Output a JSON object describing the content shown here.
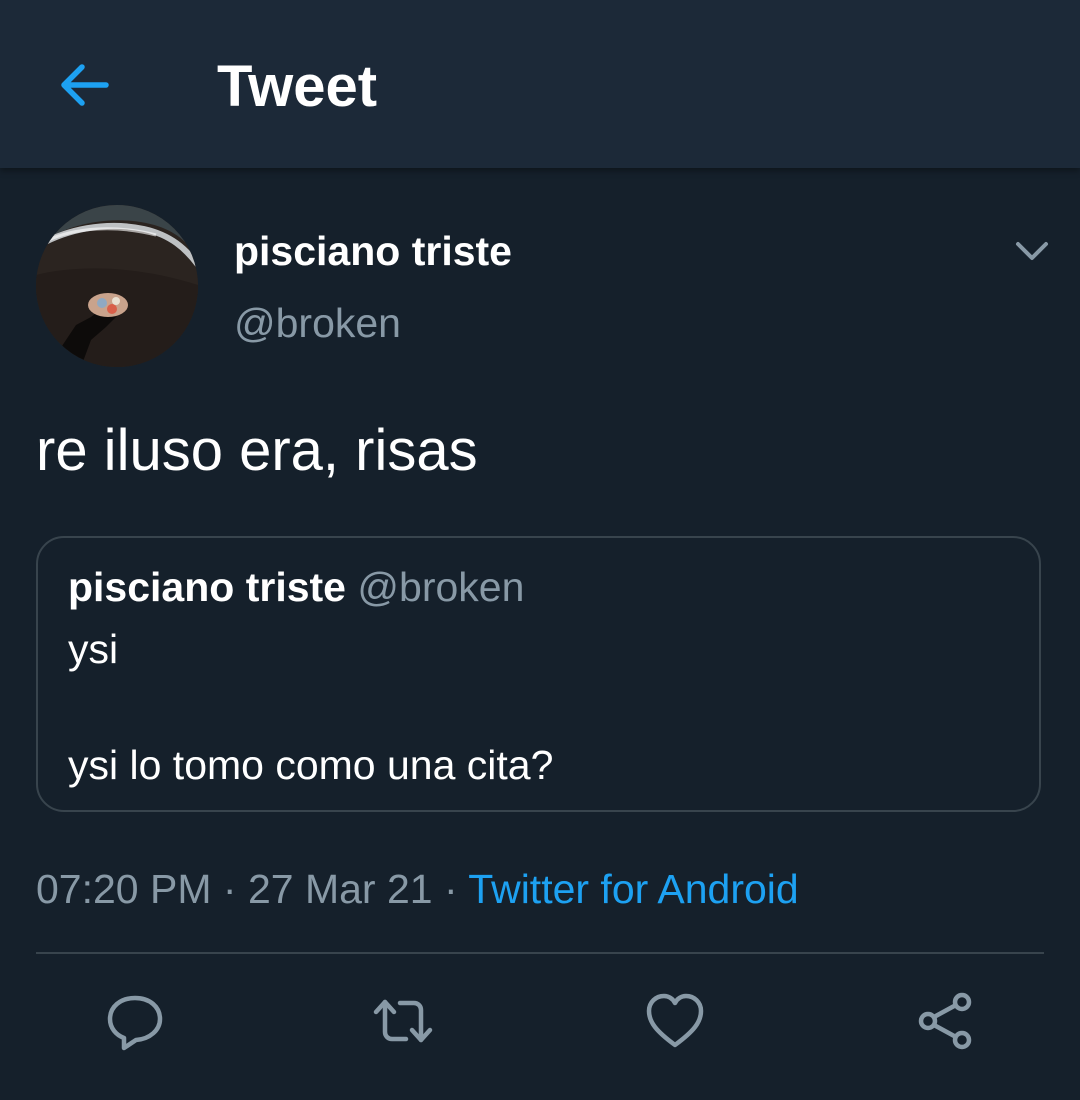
{
  "header": {
    "title": "Tweet",
    "back_icon": "arrow-left-icon",
    "accent_color": "#1da1f2"
  },
  "tweet": {
    "author_name": "pisciano triste",
    "author_handle": "@broken",
    "text": "re iluso era, risas",
    "menu_icon": "chevron-down-icon",
    "quoted": {
      "author_name": "pisciano triste",
      "author_handle": "@broken",
      "line1": "ysi",
      "line2": "ysi lo tomo como una cita?"
    },
    "time": "07:20 PM",
    "separator": "·",
    "date": "27 Mar 21",
    "source": "Twitter for Android"
  },
  "actions": [
    {
      "name": "reply",
      "icon": "comment-icon"
    },
    {
      "name": "retweet",
      "icon": "retweet-icon"
    },
    {
      "name": "like",
      "icon": "heart-icon"
    },
    {
      "name": "share",
      "icon": "share-icon"
    }
  ],
  "colors": {
    "background": "#15202b",
    "header_background": "#1c2938",
    "secondary_text": "#8899a6",
    "border": "#38444d",
    "link": "#1da1f2"
  }
}
